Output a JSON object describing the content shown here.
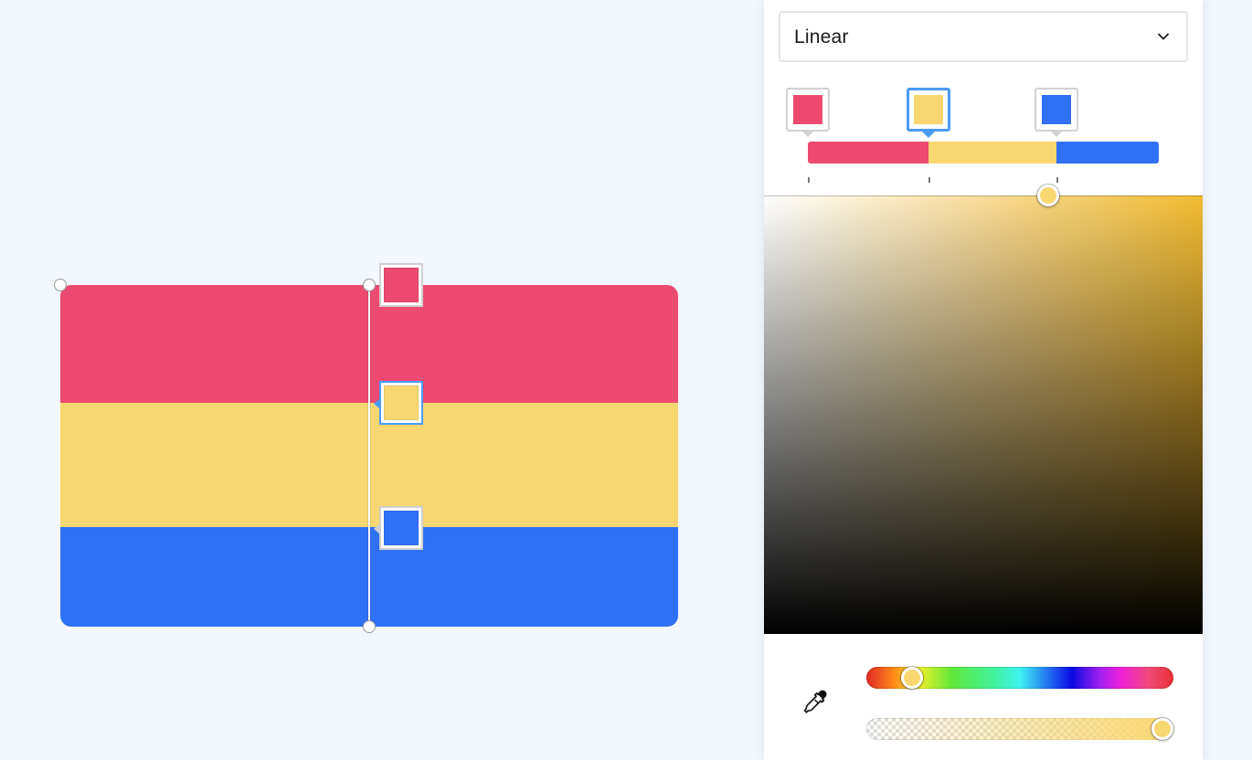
{
  "gradient": {
    "type_label": "Linear",
    "stops": [
      {
        "color": "#ec4a71",
        "position": 0.0
      },
      {
        "color": "#f9d770",
        "position": 0.345
      },
      {
        "color": "#3070f4",
        "position": 0.71
      }
    ],
    "selected_stop": 1
  },
  "picker": {
    "selected_color": "#f9d770",
    "hue_color": "#f2bb32",
    "saturation": 1.0,
    "value": 1.0,
    "hue_fraction": 0.15,
    "alpha_fraction": 1.0
  },
  "icons": {
    "type_dropdown": "chevron-down-icon",
    "eyedropper": "eyedropper-icon"
  }
}
